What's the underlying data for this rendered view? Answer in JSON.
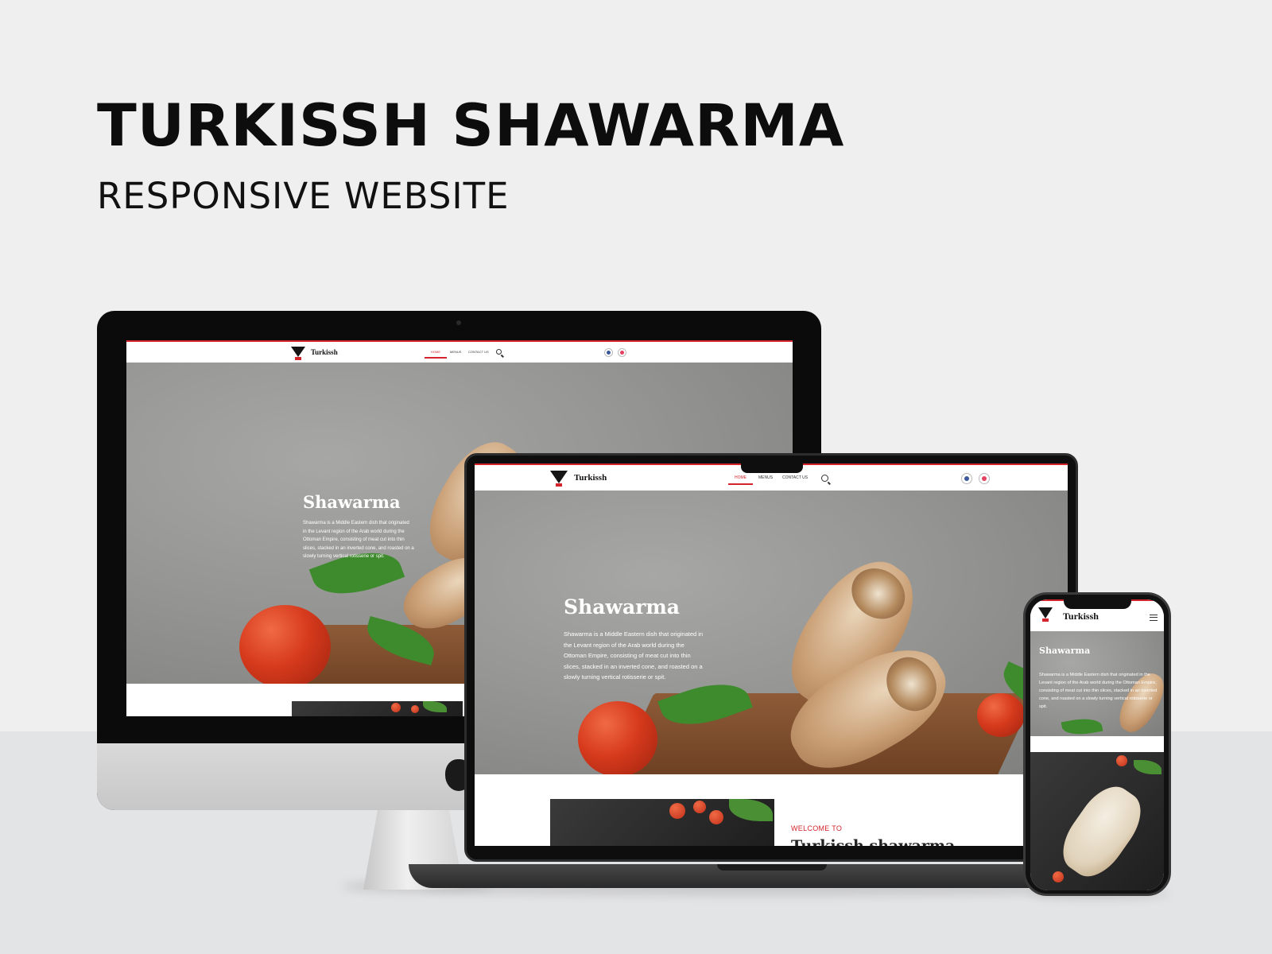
{
  "header": {
    "title": "TURKISSH SHAWARMA",
    "subtitle": "RESPONSIVE WEBSITE"
  },
  "site": {
    "brand": "Turkissh",
    "nav": [
      "HOME",
      "MENUS",
      "CONTACT US"
    ],
    "active_nav": "HOME",
    "hero_title": "Shawarma",
    "hero_text": "Shawarma is a Middle Eastern dish that originated in the Levant region of the Arab world during the Ottoman Empire, consisting of meat cut into thin slices, stacked in an inverted cone, and roasted on a slowly turning vertical rotisserie or spit.",
    "welcome_label": "WELCOME TO",
    "welcome_heading": "Turkissh shawarma"
  },
  "colors": {
    "accent": "#d3242c",
    "background": "#efefef",
    "facebook": "#3b5998",
    "instagram": "#e4405f"
  },
  "icons": [
    "search-icon",
    "facebook-icon",
    "instagram-icon",
    "menu-icon",
    "apple-logo-icon"
  ]
}
